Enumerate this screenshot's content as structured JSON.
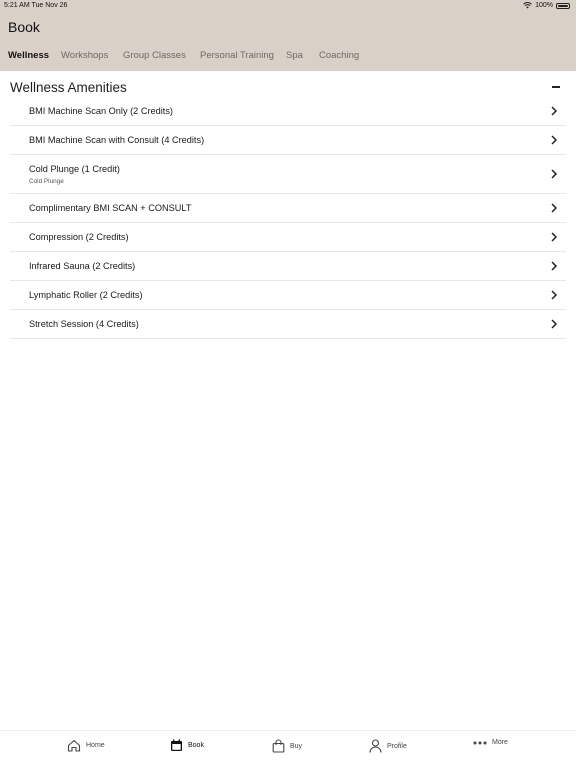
{
  "status": {
    "time": "5:21 AM Tue Nov 26",
    "battery": "100%"
  },
  "header": {
    "title": "Book"
  },
  "tabs": [
    {
      "label": "Wellness",
      "active": true
    },
    {
      "label": "Workshops"
    },
    {
      "label": "Group Classes"
    },
    {
      "label": "Personal Training"
    },
    {
      "label": "Spa"
    },
    {
      "label": "Coaching"
    }
  ],
  "section": {
    "title": "Wellness Amenities"
  },
  "items": [
    {
      "label": "BMI Machine Scan Only (2 Credits)"
    },
    {
      "label": "BMI Machine Scan with Consult (4 Credits)"
    },
    {
      "label": "Cold Plunge (1 Credit)",
      "subtitle": "Cold Plunge"
    },
    {
      "label": "Complimentary BMI SCAN + CONSULT"
    },
    {
      "label": "Compression (2 Credits)"
    },
    {
      "label": "Infrared Sauna (2 Credits)"
    },
    {
      "label": "Lymphatic Roller (2 Credits)"
    },
    {
      "label": "Stretch Session (4 Credits)"
    }
  ],
  "bottom_nav": [
    {
      "label": "Home",
      "icon": "home-icon"
    },
    {
      "label": "Book",
      "icon": "calendar-icon",
      "active": true
    },
    {
      "label": "Buy",
      "icon": "shopping-bag-icon"
    },
    {
      "label": "Profile",
      "icon": "person-icon"
    },
    {
      "label": "More",
      "icon": "more-dots-icon"
    }
  ],
  "colors": {
    "header_bg": "#d9d0c7",
    "active_tab": "#111111",
    "inactive_tab": "#6f6a66"
  }
}
